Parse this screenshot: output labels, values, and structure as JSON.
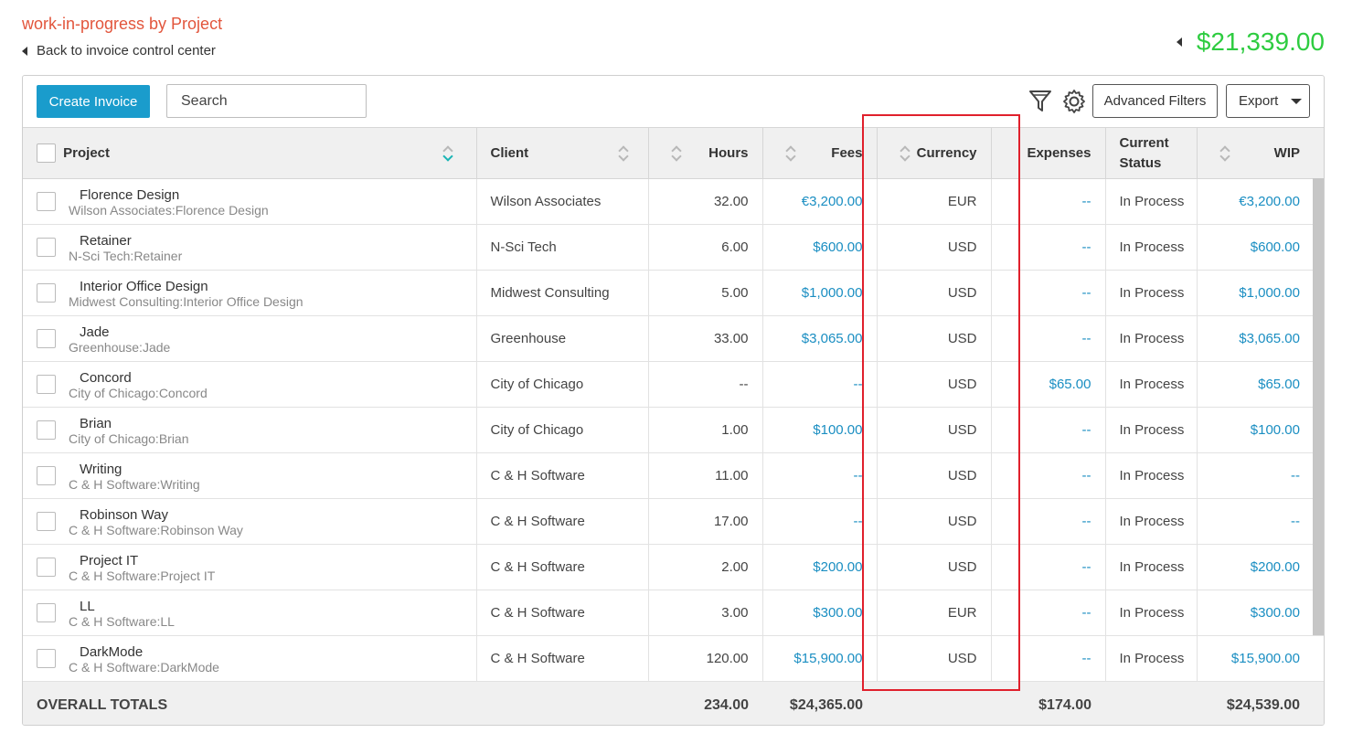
{
  "page": {
    "title": "work-in-progress by Project",
    "back_link": "Back to invoice control center",
    "total": "$21,339.00"
  },
  "toolbar": {
    "create_label": "Create Invoice",
    "search_placeholder": "Search",
    "advanced_filters_label": "Advanced Filters",
    "export_label": "Export"
  },
  "columns": {
    "project": "Project",
    "client": "Client",
    "hours": "Hours",
    "fees": "Fees",
    "currency": "Currency",
    "expenses": "Expenses",
    "status": "Current Status",
    "wip": "WIP"
  },
  "rows": [
    {
      "name": "Florence Design",
      "path": "Wilson Associates:Florence Design",
      "client": "Wilson Associates",
      "hours": "32.00",
      "fees": "€3,200.00",
      "currency": "EUR",
      "expenses": "--",
      "status": "In Process",
      "wip": "€3,200.00"
    },
    {
      "name": "Retainer",
      "path": "N-Sci Tech:Retainer",
      "client": "N-Sci Tech",
      "hours": "6.00",
      "fees": "$600.00",
      "currency": "USD",
      "expenses": "--",
      "status": "In Process",
      "wip": "$600.00"
    },
    {
      "name": "Interior Office Design",
      "path": "Midwest Consulting:Interior Office Design",
      "client": "Midwest Consulting",
      "hours": "5.00",
      "fees": "$1,000.00",
      "currency": "USD",
      "expenses": "--",
      "status": "In Process",
      "wip": "$1,000.00"
    },
    {
      "name": "Jade",
      "path": "Greenhouse:Jade",
      "client": "Greenhouse",
      "hours": "33.00",
      "fees": "$3,065.00",
      "currency": "USD",
      "expenses": "--",
      "status": "In Process",
      "wip": "$3,065.00"
    },
    {
      "name": "Concord",
      "path": "City of Chicago:Concord",
      "client": "City of Chicago",
      "hours": "--",
      "fees": "--",
      "currency": "USD",
      "expenses": "$65.00",
      "status": "In Process",
      "wip": "$65.00"
    },
    {
      "name": "Brian",
      "path": "City of Chicago:Brian",
      "client": "City of Chicago",
      "hours": "1.00",
      "fees": "$100.00",
      "currency": "USD",
      "expenses": "--",
      "status": "In Process",
      "wip": "$100.00"
    },
    {
      "name": "Writing",
      "path": "C & H Software:Writing",
      "client": "C & H Software",
      "hours": "11.00",
      "fees": "--",
      "currency": "USD",
      "expenses": "--",
      "status": "In Process",
      "wip": "--"
    },
    {
      "name": "Robinson Way",
      "path": "C & H Software:Robinson Way",
      "client": "C & H Software",
      "hours": "17.00",
      "fees": "--",
      "currency": "USD",
      "expenses": "--",
      "status": "In Process",
      "wip": "--"
    },
    {
      "name": "Project IT",
      "path": "C & H Software:Project IT",
      "client": "C & H Software",
      "hours": "2.00",
      "fees": "$200.00",
      "currency": "USD",
      "expenses": "--",
      "status": "In Process",
      "wip": "$200.00"
    },
    {
      "name": "LL",
      "path": "C & H Software:LL",
      "client": "C & H Software",
      "hours": "3.00",
      "fees": "$300.00",
      "currency": "EUR",
      "expenses": "--",
      "status": "In Process",
      "wip": "$300.00"
    },
    {
      "name": "DarkMode",
      "path": "C & H Software:DarkMode",
      "client": "C & H Software",
      "hours": "120.00",
      "fees": "$15,900.00",
      "currency": "USD",
      "expenses": "--",
      "status": "In Process",
      "wip": "$15,900.00"
    }
  ],
  "totals": {
    "label": "OVERALL TOTALS",
    "hours": "234.00",
    "fees": "$24,365.00",
    "expenses": "$174.00",
    "wip": "$24,539.00"
  },
  "colors": {
    "title": "#e2553c",
    "total": "#2ecc40",
    "primary_button": "#1a9ccc",
    "link": "#1a8ec2",
    "highlight_box": "#e0202c"
  }
}
